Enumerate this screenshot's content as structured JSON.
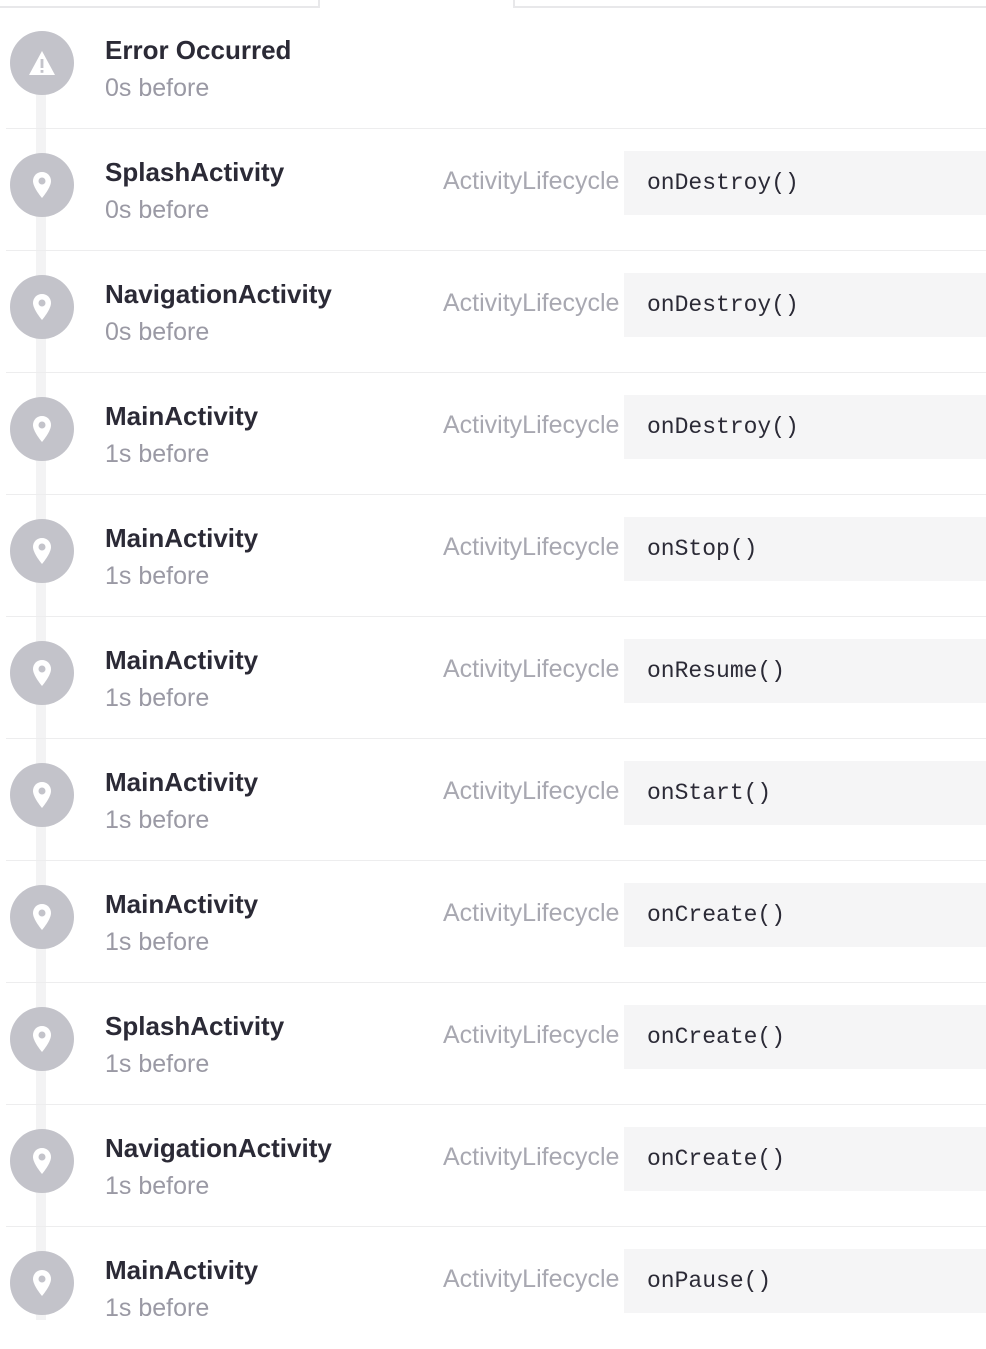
{
  "colors": {
    "icon_bg": "#c3c3ca",
    "title_text": "#2b2a36",
    "muted_text": "#9a99a4",
    "message_bg": "#f5f5f6"
  },
  "crumbs": [
    {
      "icon": "warning-icon",
      "title": "Error Occurred",
      "time": "0s before",
      "category": "",
      "message": ""
    },
    {
      "icon": "location-pin-icon",
      "title": "SplashActivity",
      "time": "0s before",
      "category": "ActivityLifecycle",
      "message": "onDestroy()"
    },
    {
      "icon": "location-pin-icon",
      "title": "NavigationActivity",
      "time": "0s before",
      "category": "ActivityLifecycle",
      "message": "onDestroy()"
    },
    {
      "icon": "location-pin-icon",
      "title": "MainActivity",
      "time": "1s before",
      "category": "ActivityLifecycle",
      "message": "onDestroy()"
    },
    {
      "icon": "location-pin-icon",
      "title": "MainActivity",
      "time": "1s before",
      "category": "ActivityLifecycle",
      "message": "onStop()"
    },
    {
      "icon": "location-pin-icon",
      "title": "MainActivity",
      "time": "1s before",
      "category": "ActivityLifecycle",
      "message": "onResume()"
    },
    {
      "icon": "location-pin-icon",
      "title": "MainActivity",
      "time": "1s before",
      "category": "ActivityLifecycle",
      "message": "onStart()"
    },
    {
      "icon": "location-pin-icon",
      "title": "MainActivity",
      "time": "1s before",
      "category": "ActivityLifecycle",
      "message": "onCreate()"
    },
    {
      "icon": "location-pin-icon",
      "title": "SplashActivity",
      "time": "1s before",
      "category": "ActivityLifecycle",
      "message": "onCreate()"
    },
    {
      "icon": "location-pin-icon",
      "title": "NavigationActivity",
      "time": "1s before",
      "category": "ActivityLifecycle",
      "message": "onCreate()"
    },
    {
      "icon": "location-pin-icon",
      "title": "MainActivity",
      "time": "1s before",
      "category": "ActivityLifecycle",
      "message": "onPause()"
    }
  ]
}
